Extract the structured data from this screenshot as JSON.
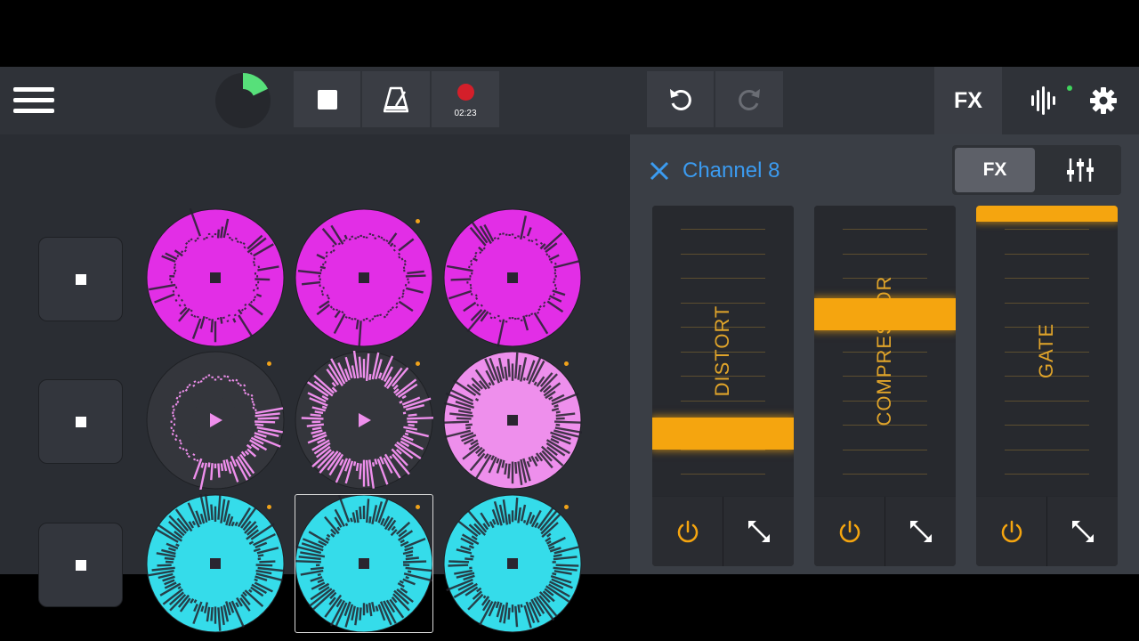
{
  "toolbar": {
    "menu_icon": "hamburger-menu-icon",
    "progress_fraction": 0.18,
    "record_time": "02:23",
    "fx_label": "FX",
    "live_indicator_color": "#3fd45c"
  },
  "stop_buttons": [
    {
      "icon": "stop-icon"
    },
    {
      "icon": "stop-icon"
    },
    {
      "icon": "stop-icon"
    }
  ],
  "pads": [
    {
      "row": 0,
      "col": 0,
      "color": "#e22ee6",
      "state": "playing",
      "dot": false
    },
    {
      "row": 0,
      "col": 1,
      "color": "#e22ee6",
      "state": "playing",
      "dot": true
    },
    {
      "row": 0,
      "col": 2,
      "color": "#e22ee6",
      "state": "playing",
      "dot": false
    },
    {
      "row": 1,
      "col": 0,
      "color": "#ee8fec",
      "state": "idle",
      "dot": true
    },
    {
      "row": 1,
      "col": 1,
      "color": "#ee8fec",
      "state": "idle",
      "dot": true
    },
    {
      "row": 1,
      "col": 2,
      "color": "#ee8fec",
      "state": "playing",
      "dot": true
    },
    {
      "row": 2,
      "col": 0,
      "color": "#35dcea",
      "state": "playing",
      "dot": true
    },
    {
      "row": 2,
      "col": 1,
      "color": "#35dcea",
      "state": "playing",
      "dot": true,
      "selected": true
    },
    {
      "row": 2,
      "col": 2,
      "color": "#35dcea",
      "state": "playing",
      "dot": true
    }
  ],
  "fx_panel": {
    "title": "Channel 8",
    "tab_fx": "FX",
    "accent_color": "#f5a50f",
    "title_color": "#3b9bf0",
    "effects": [
      {
        "name": "DISTORT",
        "level": 0.18
      },
      {
        "name": "COMPRESSOR",
        "level": 0.64
      },
      {
        "name": "GATE",
        "level": 1.0
      }
    ]
  }
}
